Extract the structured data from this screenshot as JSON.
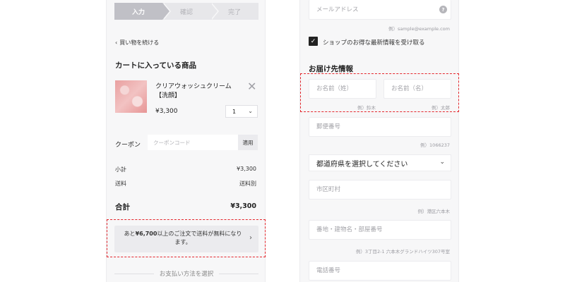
{
  "stepper": {
    "steps": [
      "入力",
      "確認",
      "完了"
    ]
  },
  "cart": {
    "back_link": "買い物を続ける",
    "heading": "カートに入っている商品",
    "item": {
      "name": "クリアウォッシュクリーム【洗顔】",
      "price": "¥3,300",
      "quantity": "1"
    },
    "coupon": {
      "label": "クーポン",
      "placeholder": "クーポンコード",
      "apply_label": "適用"
    },
    "subtotal_label": "小計",
    "subtotal_value": "¥3,300",
    "shipping_label": "送料",
    "shipping_value": "送料別",
    "total_label": "合計",
    "total_value": "¥3,300",
    "free_shipping_note_pre": "あと",
    "free_shipping_note_amount": "¥6,700",
    "free_shipping_note_post": "以上のご注文で送料が無料になります。",
    "payment_heading": "お支払い方法を選択"
  },
  "form": {
    "email_placeholder": "メールアドレス",
    "email_hint": "例）sample@example.com",
    "newsletter_label": "ショップのお得な最新情報を受け取る",
    "shipping_heading": "お届け先情報",
    "last_name_placeholder": "お名前（姓）",
    "last_name_hint": "例）鈴木",
    "first_name_placeholder": "お名前（名）",
    "first_name_hint": "例）太郎",
    "postal_placeholder": "郵便番号",
    "postal_hint": "例）1066237",
    "prefecture_label": "都道府県を選択してください",
    "city_placeholder": "市区町村",
    "city_hint": "例）港区六本木",
    "address_placeholder": "番地・建物名・部屋番号",
    "address_hint": "例）3丁目2-1 六本木グランドハイツ307号室",
    "phone_placeholder": "電話番号"
  },
  "icons": {
    "back": "chevron-left-icon",
    "remove": "close-icon",
    "select": "chevron-down-icon",
    "note": "chevron-right-icon",
    "help": "question-icon",
    "check": "check-icon"
  },
  "colors": {
    "highlight": "#e4262c",
    "panel_bg": "#f7f7f8",
    "step_active": "#c0c0c6"
  }
}
